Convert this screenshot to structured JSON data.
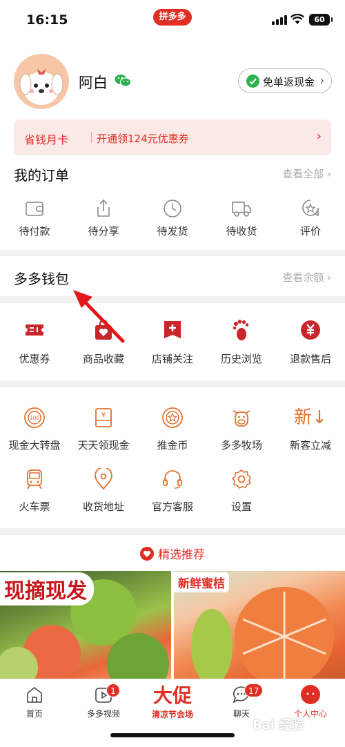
{
  "status_bar": {
    "time": "16:15",
    "app_badge": "拼多多",
    "battery": "60"
  },
  "profile": {
    "username": "阿白",
    "cashback_button": "免单返现金",
    "month_card_title": "省钱月卡",
    "month_card_desc": "开通领124元优惠券"
  },
  "orders": {
    "title": "我的订单",
    "view_all": "查看全部",
    "items": [
      {
        "label": "待付款",
        "icon": "wallet-icon"
      },
      {
        "label": "待分享",
        "icon": "share-icon"
      },
      {
        "label": "待发货",
        "icon": "clock-icon"
      },
      {
        "label": "待收货",
        "icon": "truck-icon"
      },
      {
        "label": "评价",
        "icon": "review-icon"
      }
    ]
  },
  "wallet": {
    "title": "多多钱包",
    "view_balance": "查看余额"
  },
  "shortcuts": [
    {
      "label": "优惠券",
      "icon": "coupon-icon"
    },
    {
      "label": "商品收藏",
      "icon": "favorite-bag-icon"
    },
    {
      "label": "店铺关注",
      "icon": "store-follow-icon"
    },
    {
      "label": "历史浏览",
      "icon": "footprint-icon"
    },
    {
      "label": "退款售后",
      "icon": "refund-icon"
    }
  ],
  "grid": [
    {
      "label": "现金大转盘",
      "icon": "wheel-icon"
    },
    {
      "label": "天天领现金",
      "icon": "cash-envelope-icon"
    },
    {
      "label": "推金币",
      "icon": "coin-icon"
    },
    {
      "label": "多多牧场",
      "icon": "cow-icon"
    },
    {
      "label": "新客立减",
      "icon": "new-discount-icon",
      "glyph": "新↓"
    },
    {
      "label": "火车票",
      "icon": "train-icon"
    },
    {
      "label": "收货地址",
      "icon": "location-icon"
    },
    {
      "label": "官方客服",
      "icon": "headset-icon"
    },
    {
      "label": "设置",
      "icon": "settings-icon"
    }
  ],
  "recommend": {
    "title": "精选推荐",
    "products": [
      {
        "tag": "现摘现发"
      },
      {
        "tag": "新鲜蜜桔"
      }
    ]
  },
  "tabbar": {
    "home": "首页",
    "video": "多多视频",
    "video_badge": "1",
    "promo_big": "大促",
    "promo_sub": "清凉节会场",
    "chat": "聊天",
    "chat_badge": "17",
    "me": "个人中心"
  },
  "watermark": "Bai 经验",
  "colors": {
    "brand_red": "#e02e24",
    "pale_red": "#fbe9e7",
    "wechat_green": "#2bb24c",
    "icon_orange": "#e46f2c"
  }
}
